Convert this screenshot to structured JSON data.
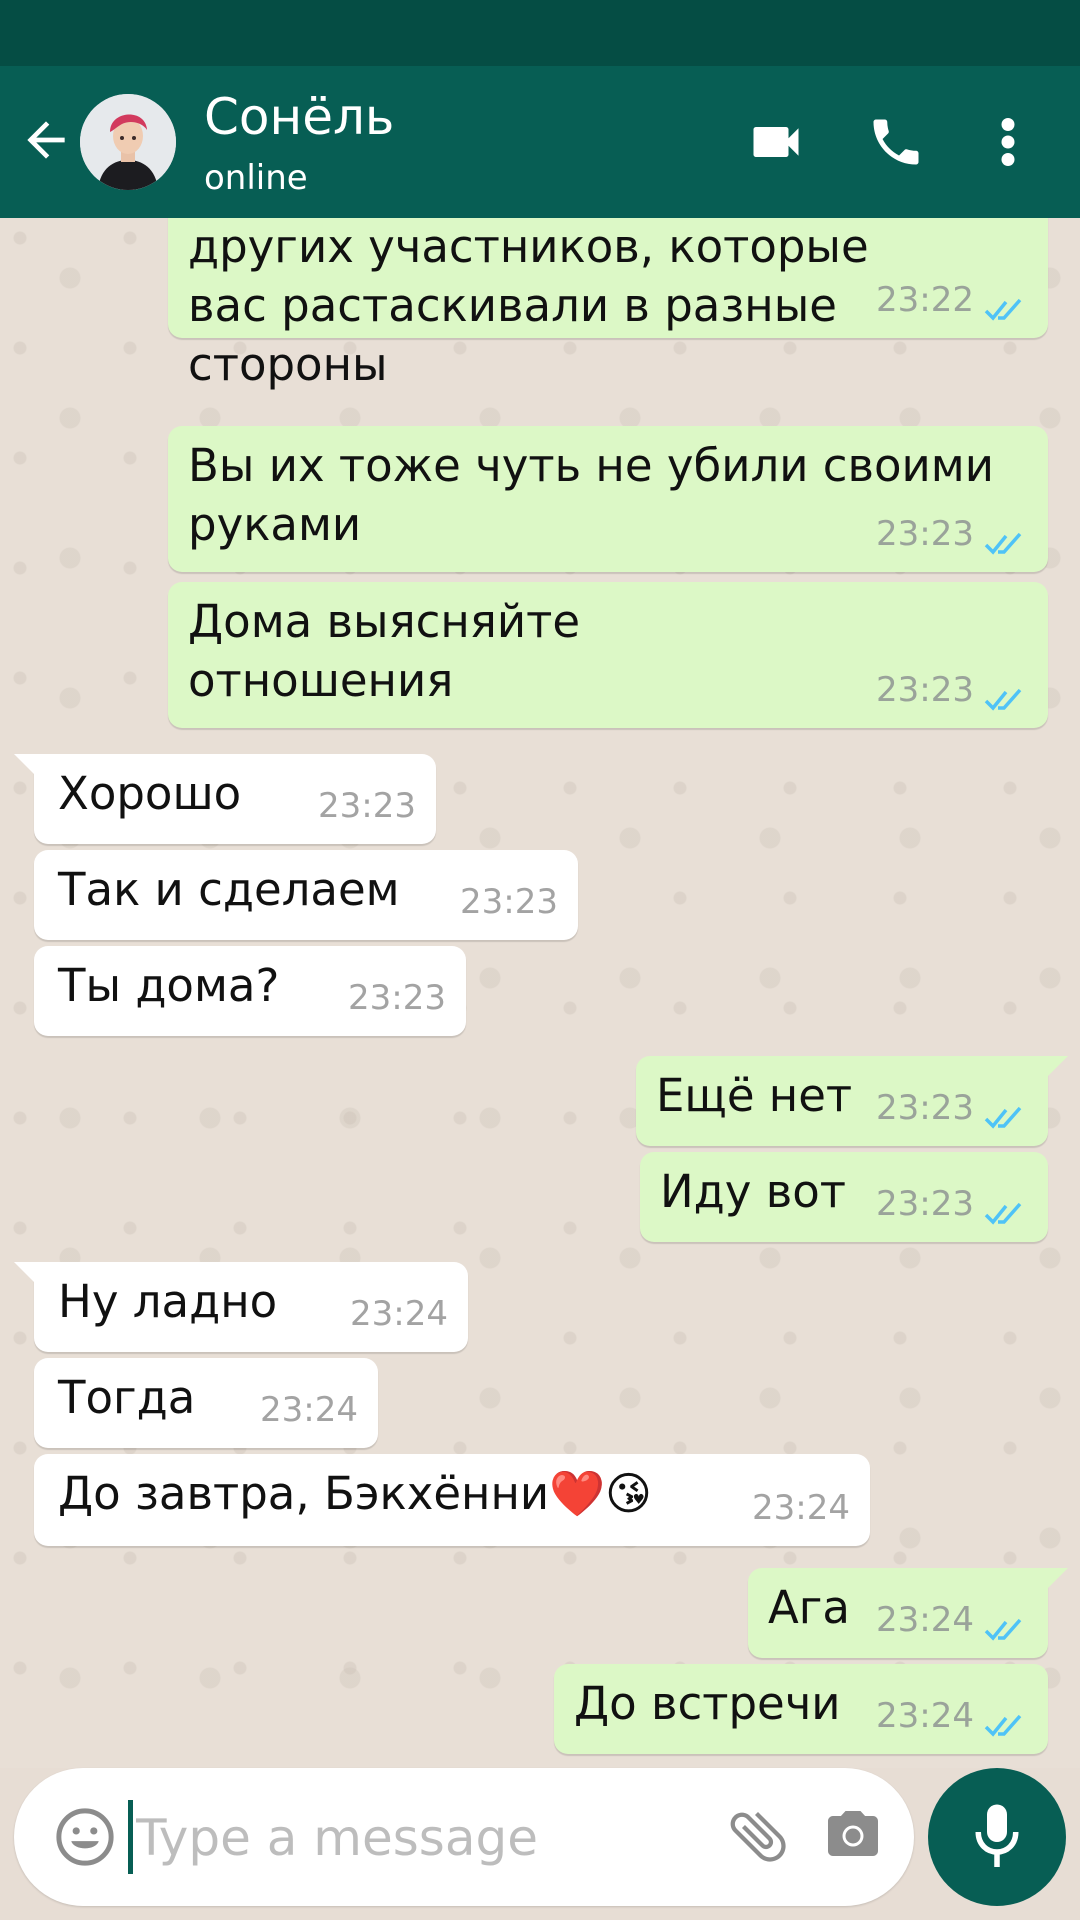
{
  "header": {
    "contact_name": "Сонёль",
    "status": "online",
    "icons": [
      "back-arrow-icon",
      "video-call-icon",
      "phone-icon",
      "more-vert-icon"
    ],
    "colors": {
      "bar": "#075e54",
      "statusbar": "#054d44"
    }
  },
  "messages": [
    {
      "dir": "out",
      "text": "и поранили сильно бы\nдругих участников, которые\nвас растаскивали в разные\nстороны",
      "time": "23:22",
      "read": true
    },
    {
      "dir": "out",
      "text": "Вы их тоже чуть не убили своими\nруками",
      "time": "23:23",
      "read": true
    },
    {
      "dir": "out",
      "text": "Дома выясняйте\nотношения",
      "time": "23:23",
      "read": true
    },
    {
      "dir": "in",
      "text": "Хорошо",
      "time": "23:23"
    },
    {
      "dir": "in",
      "text": "Так и сделаем",
      "time": "23:23"
    },
    {
      "dir": "in",
      "text": "Ты дома?",
      "time": "23:23"
    },
    {
      "dir": "out",
      "text": "Ещё нет",
      "time": "23:23",
      "read": true
    },
    {
      "dir": "out",
      "text": "Иду вот",
      "time": "23:23",
      "read": true
    },
    {
      "dir": "in",
      "text": "Ну ладно",
      "time": "23:24"
    },
    {
      "dir": "in",
      "text": "Тогда",
      "time": "23:24"
    },
    {
      "dir": "in",
      "text": "До завтра, Бэкхённи❤️😘",
      "time": "23:24"
    },
    {
      "dir": "out",
      "text": "Ага",
      "time": "23:24",
      "read": true
    },
    {
      "dir": "out",
      "text": "До встречи",
      "time": "23:24",
      "read": true
    }
  ],
  "composer": {
    "placeholder": "Type a message",
    "icons": [
      "emoji-icon",
      "attach-icon",
      "camera-icon",
      "mic-icon"
    ]
  },
  "colors": {
    "outgoing_bubble": "#dcf8c6",
    "incoming_bubble": "#ffffff",
    "read_ticks": "#4fc3f7"
  }
}
